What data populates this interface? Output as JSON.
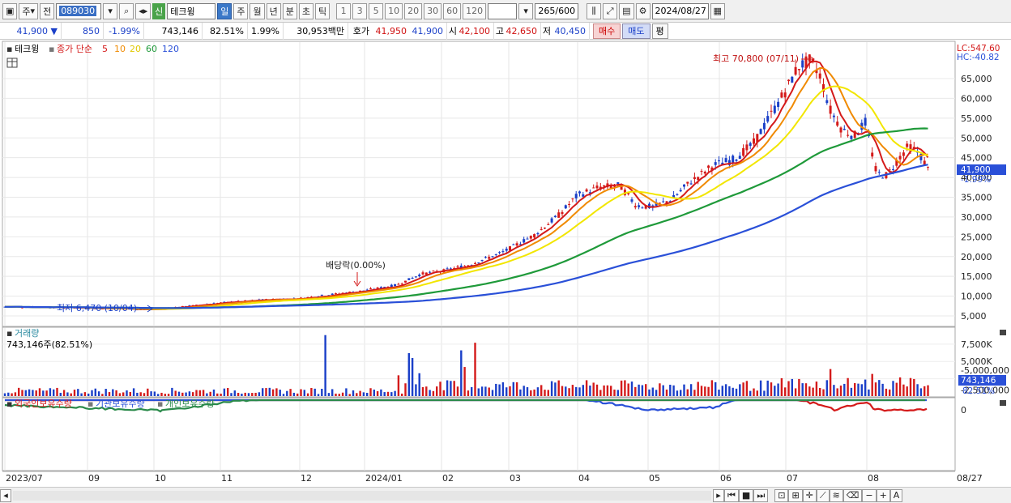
{
  "toolbar": {
    "type_label": "주",
    "prev_label": "전",
    "code": "089030",
    "new_badge": "신",
    "stock_name": "테크윙",
    "periods": [
      "일",
      "주",
      "월",
      "년",
      "분",
      "초",
      "틱"
    ],
    "active_period": "일",
    "intervals": [
      "1",
      "3",
      "5",
      "10",
      "20",
      "30",
      "60",
      "120"
    ],
    "count": "265",
    "count_total": "/600",
    "date": "2024/08/27"
  },
  "quote": {
    "price": "41,900",
    "direction": "▼",
    "change": "850",
    "change_pct": "-1.99%",
    "volume": "743,146",
    "vol_ratio": "82.51%",
    "turnover_rate": "1.99%",
    "amount": "30,953백만",
    "bid_label": "호가",
    "bid_ask": "41,950",
    "bid": "41,900",
    "open_label": "시",
    "open": "42,100",
    "high_label": "고",
    "high": "42,650",
    "low_label": "저",
    "low": "40,450",
    "buy_label": "매수",
    "sell_label": "매도",
    "avg_label": "평"
  },
  "price_panel": {
    "title": "테크윙",
    "ma_label": "종가 단순",
    "ma_periods": [
      "5",
      "10",
      "20",
      "60",
      "120"
    ],
    "ma_colors": [
      "#d41a1a",
      "#f08a00",
      "#f2e600",
      "#1f9a3a",
      "#2a50d8"
    ],
    "lc": "LC:547.60",
    "hc": "HC:-40.82",
    "max_annotation": "최고 70,800 (07/11)",
    "min_annotation": "최저 6,470 (10/04)",
    "dividend_annotation": "배당락(0.00%)",
    "current_price_tag": "41,900",
    "current_pct_tag": "-1.99%",
    "y_ticks": [
      "65,000",
      "60,000",
      "55,000",
      "50,000",
      "45,000",
      "40,000",
      "35,000",
      "30,000",
      "25,000",
      "20,000",
      "15,000",
      "10,000",
      "5,000"
    ]
  },
  "volume_panel": {
    "title": "거래량",
    "subtitle": "743,146주(82.51%)",
    "y_ticks": [
      "7,500K",
      "5,000K",
      "2,500K"
    ],
    "current_tag": "743,146",
    "current_pct": "82.51%"
  },
  "holding_panel": {
    "legend": [
      "외국인보유수량",
      "기관보유수량",
      "개인보유수량"
    ],
    "legend_colors": [
      "#d41a1a",
      "#2a50d8",
      "#2a8a4a"
    ],
    "y_ticks": [
      "0",
      "-2,500,000",
      "-5,000,000"
    ]
  },
  "x_axis": {
    "labels": [
      "2023/07",
      "09",
      "10",
      "11",
      "12",
      "2024/01",
      "02",
      "03",
      "04",
      "05",
      "06",
      "07",
      "08",
      "08/27"
    ]
  },
  "chart_data": {
    "type": "candlestick",
    "x_labels": [
      "2023/07",
      "09",
      "10",
      "11",
      "12",
      "2024/01",
      "02",
      "03",
      "04",
      "05",
      "06",
      "07",
      "08"
    ],
    "close_points": [
      [
        "2023/07",
        7300
      ],
      [
        "2023/08",
        7000
      ],
      [
        "2023/09",
        6800
      ],
      [
        "2023/10",
        6800
      ],
      [
        "2023/11",
        8300
      ],
      [
        "2023/12",
        9500
      ],
      [
        "2024/01",
        11500
      ],
      [
        "2024/02",
        15500
      ],
      [
        "2024/03",
        21000
      ],
      [
        "2024/04",
        36000
      ],
      [
        "2024/05",
        33000
      ],
      [
        "2024/06",
        44000
      ],
      [
        "2024/07",
        68000
      ],
      [
        "2024/07b",
        53000
      ],
      [
        "2024/08",
        39000
      ],
      [
        "2024/08/27",
        41900
      ]
    ],
    "ylim": [
      5000,
      70800
    ],
    "max": 70800,
    "min": 6470
  }
}
